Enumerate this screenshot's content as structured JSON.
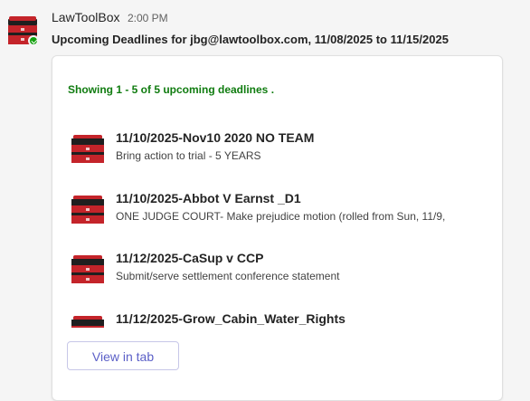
{
  "message": {
    "sender": "LawToolBox",
    "time": "2:00 PM",
    "subject": "Upcoming Deadlines for jbg@lawtoolbox.com, 11/08/2025 to 11/15/2025"
  },
  "card": {
    "showing_text": "Showing 1 - 5 of 5 upcoming deadlines .",
    "items": [
      {
        "title": "11/10/2025-Nov10 2020 NO TEAM",
        "desc": "Bring action to trial - 5 YEARS"
      },
      {
        "title": "11/10/2025-Abbot V Earnst _D1",
        "desc": "ONE JUDGE COURT- Make prejudice motion (rolled from Sun, 11/9,"
      },
      {
        "title": "11/12/2025-CaSup v CCP",
        "desc": "Submit/serve settlement conference statement"
      },
      {
        "title": "11/12/2025-Grow_Cabin_Water_Rights",
        "desc": ""
      }
    ],
    "view_button": "View in tab"
  },
  "colors": {
    "accent": "#5b5fc7",
    "showing_green": "#107c10",
    "toolbox_red": "#c4242a",
    "status_green": "#13a10e"
  },
  "icons": {
    "avatar": "toolbox-icon",
    "item": "toolbox-icon",
    "status": "available-check-icon"
  }
}
